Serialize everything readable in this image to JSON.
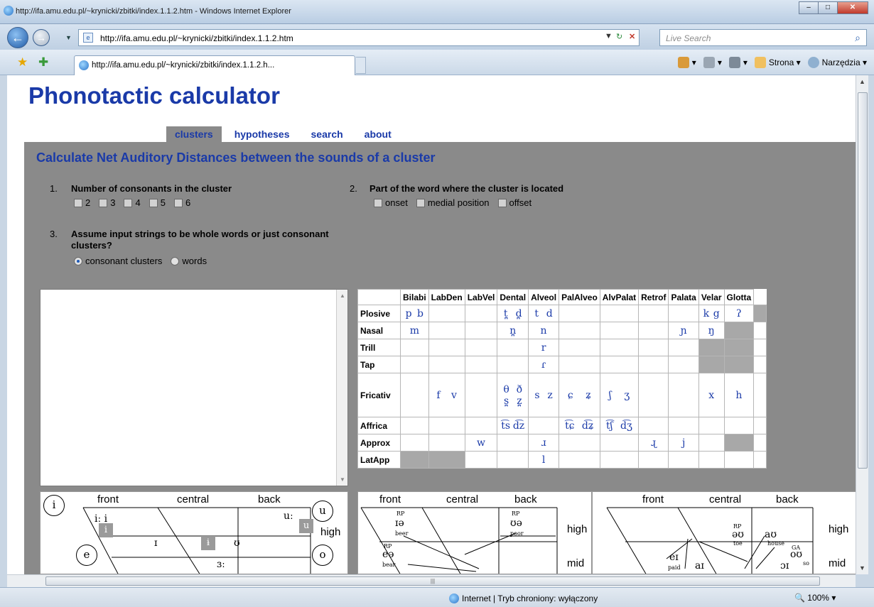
{
  "window": {
    "title": "http://ifa.amu.edu.pl/~krynicki/zbitki/index.1.1.2.htm - Windows Internet Explorer",
    "url": "http://ifa.amu.edu.pl/~krynicki/zbitki/index.1.1.2.htm",
    "search_placeholder": "Live Search",
    "tab_label": "http://ifa.amu.edu.pl/~krynicki/zbitki/index.1.1.2.h...",
    "cmd_strona": "Strona",
    "cmd_narzedzia": "Narzędzia",
    "status_zone": "Internet | Tryb chroniony: wyłączony",
    "zoom": "100%"
  },
  "page": {
    "title": "Phonotactic calculator",
    "nav": [
      "clusters",
      "hypotheses",
      "search",
      "about"
    ],
    "nav_active": "clusters",
    "heading": "Calculate Net Auditory Distances between the sounds of a cluster",
    "q1": {
      "num": "1.",
      "text": "Number of consonants in the cluster",
      "options": [
        "2",
        "3",
        "4",
        "5",
        "6"
      ]
    },
    "q2": {
      "num": "2.",
      "text": "Part of the word where the cluster is located",
      "options": [
        "onset",
        "medial position",
        "offset"
      ]
    },
    "q3": {
      "num": "3.",
      "text": "Assume input strings to be whole words or just consonant clusters?",
      "options": [
        "consonant clusters",
        "words"
      ],
      "selected": "consonant clusters"
    }
  },
  "ipa": {
    "columns": [
      "Bilabi",
      "LabDen",
      "LabVel",
      "Dental",
      "Alveol",
      "PalAlveo",
      "AlvPalat",
      "Retrof",
      "Palata",
      "Velar",
      "Glotta"
    ],
    "rows": [
      {
        "label": "Plosive",
        "cells": [
          "p b",
          "",
          "",
          "t̪ d̪",
          "t d",
          "",
          "",
          "",
          "",
          "k g",
          "ʔ"
        ]
      },
      {
        "label": "Nasal",
        "cells": [
          "m",
          "",
          "",
          "n̪",
          "n",
          "",
          "",
          "",
          "ɲ",
          "ŋ",
          ""
        ]
      },
      {
        "label": "Trill",
        "cells": [
          "",
          "",
          "",
          "",
          "r",
          "",
          "",
          "",
          "",
          "",
          ""
        ]
      },
      {
        "label": "Tap",
        "cells": [
          "",
          "",
          "",
          "",
          "ɾ",
          "",
          "",
          "",
          "",
          "",
          ""
        ]
      },
      {
        "label": "Fricativ",
        "cells": [
          "",
          "f v",
          "",
          "θ ð s̪ z̪",
          "s z",
          "ɕ ʑ",
          "ʃ ʒ",
          "",
          "",
          "x",
          "h"
        ]
      },
      {
        "label": "Affrica",
        "cells": [
          "",
          "",
          "",
          "t͡s d͡z",
          "",
          "t͡ɕ d͡ʑ",
          "t͡ʃ d͡ʒ",
          "",
          "",
          "",
          ""
        ]
      },
      {
        "label": "Approx",
        "cells": [
          "",
          "",
          "w",
          "",
          "ɹ",
          "",
          "",
          "ɻ",
          "j",
          "",
          ""
        ]
      },
      {
        "label": "LatApp",
        "cells": [
          "",
          "",
          "",
          "",
          "l",
          "",
          "",
          "",
          "",
          "",
          ""
        ]
      }
    ]
  },
  "vowels1": {
    "front": "front",
    "central": "central",
    "back": "back",
    "high": "high",
    "symbols": {
      "iːi": "iː i",
      "uː": "uː",
      "I": "ɪ",
      "U": "ʊ",
      "er": "ɜː"
    },
    "circles": {
      "i": "i",
      "u": "u",
      "e": "e",
      "o": "o"
    },
    "boxes": {
      "i": "i",
      "u": "u",
      "ibar": "ɨ"
    }
  },
  "vowels2": {
    "front": "front",
    "central": "central",
    "back": "back",
    "high": "high",
    "mid": "mid",
    "rp1": "RP",
    "rp2": "RP",
    "rp3": "RP",
    "ia": "ɪə",
    "ua": "ʊə",
    "ea": "eə",
    "beer": "beer",
    "poor": "poor",
    "bear": "bear"
  },
  "vowels3": {
    "front": "front",
    "central": "central",
    "back": "back",
    "high": "high",
    "mid": "mid",
    "rp": "RP",
    "ga": "GA",
    "ou": "əʊ",
    "au": "aʊ",
    "ou2": "oʊ",
    "ei": "eɪ",
    "ai": "aɪ",
    "oi": "ɔɪ",
    "toe": "toe",
    "house": "house",
    "so": "so",
    "paid": "paid"
  }
}
